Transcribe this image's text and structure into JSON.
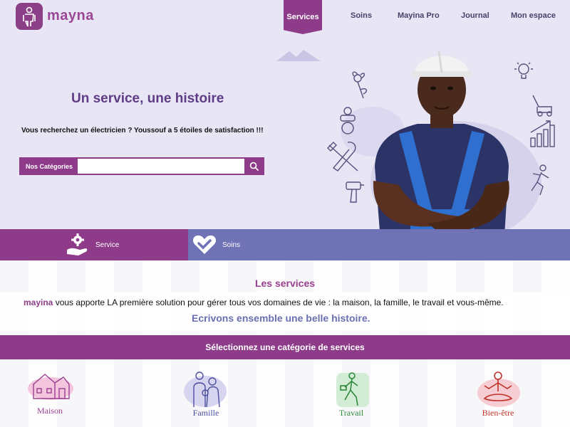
{
  "header": {
    "brand": "mayna",
    "nav": {
      "services": "Services",
      "soins": "Soins",
      "pro": "Mayina Pro",
      "journal": "Journal",
      "espace": "Mon espace"
    }
  },
  "hero": {
    "title": "Un service, une histoire",
    "subtitle": "Vous recherchez un électricien ? Youssouf a 5 étoiles de satisfaction !!!",
    "search": {
      "label": "Nos Catégories",
      "value": ""
    }
  },
  "tabs": {
    "service": "Service",
    "soins": "Soins"
  },
  "services": {
    "title": "Les services",
    "brand": "mayina",
    "description": " vous apporte LA première solution pour gérer tous vos domaines de vie : la maison, la famille, le travail et vous-même.",
    "tagline": "Ecrivons ensemble une belle histoire.",
    "category_bar": "Sélectionnez une catégorie de services",
    "categories": [
      {
        "label": "Maison",
        "color": "#9a3f8f"
      },
      {
        "label": "Famille",
        "color": "#4b4fa0"
      },
      {
        "label": "Travail",
        "color": "#2f8a3c"
      },
      {
        "label": "Bien-être",
        "color": "#c2302a"
      }
    ]
  },
  "colors": {
    "primary": "#8e3c8a",
    "secondary": "#6f72b4",
    "hero_bg": "#e8e5f5"
  }
}
